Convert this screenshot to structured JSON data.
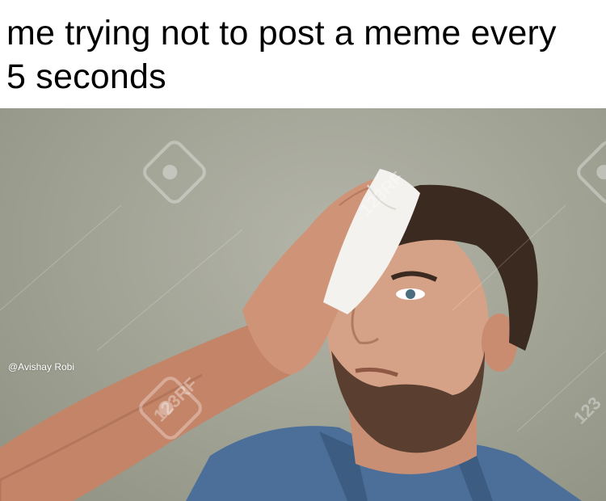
{
  "caption": {
    "line1": "me trying not to post a meme every",
    "line2": "5 seconds"
  },
  "photo": {
    "credit": "@Avishay Robi",
    "watermarks": [
      "123RF",
      "123RF",
      "123"
    ]
  }
}
